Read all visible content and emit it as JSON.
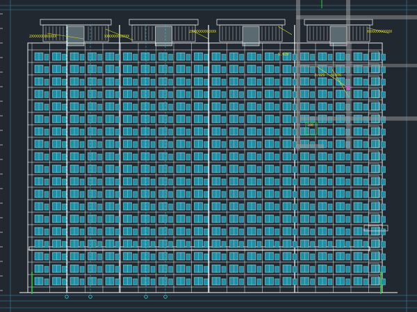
{
  "cad": {
    "background_color": "#212830",
    "line_color": "#ffffff",
    "window_color": "#1f8fa6",
    "annotation_color": "#e6e62a",
    "leader_color": "#33d6e0",
    "highlight_color": "#e026e0",
    "crosshair_color": "#9a9a9a",
    "grid_line_color": "#2f6f8c",
    "ground_marker_color": "#2ecc40",
    "floors_count": 19
  },
  "annotations": {
    "roof_note_a": "2XXXXXXXXXXXX",
    "roof_note_b": "XXXXXXXXXXXX",
    "roof_note_c": "2XXXXXXXXXXXX",
    "roof_note_d": "XXXXXXXXXXXX",
    "dim_1": "5.929",
    "dim_2": "3.929",
    "dim_3": "5.376",
    "dim_4": "100"
  }
}
